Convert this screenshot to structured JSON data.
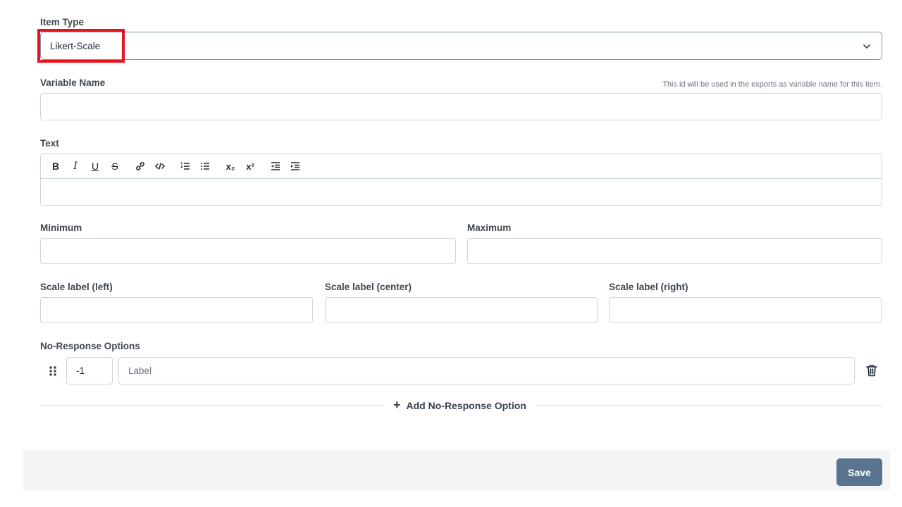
{
  "item_type": {
    "label": "Item Type",
    "value": "Likert-Scale"
  },
  "variable_name": {
    "label": "Variable Name",
    "hint": "This id will be used in the exports as variable name for this item.",
    "value": ""
  },
  "text": {
    "label": "Text",
    "toolbar": {
      "bold": "B",
      "italic": "I",
      "underline": "U",
      "strike": "S",
      "subscript": "x₂",
      "superscript": "x²"
    },
    "value": ""
  },
  "minimum": {
    "label": "Minimum",
    "value": ""
  },
  "maximum": {
    "label": "Maximum",
    "value": ""
  },
  "scale_labels": {
    "left": {
      "label": "Scale label (left)",
      "value": ""
    },
    "center": {
      "label": "Scale label (center)",
      "value": ""
    },
    "right": {
      "label": "Scale label (right)",
      "value": ""
    }
  },
  "no_response": {
    "label": "No-Response Options",
    "options": [
      {
        "value": "-1",
        "label_placeholder": "Label"
      }
    ],
    "add_label": "Add No-Response Option"
  },
  "footer": {
    "save_label": "Save"
  },
  "colors": {
    "highlight": "#e8121b",
    "save_button": "#5a7490"
  }
}
